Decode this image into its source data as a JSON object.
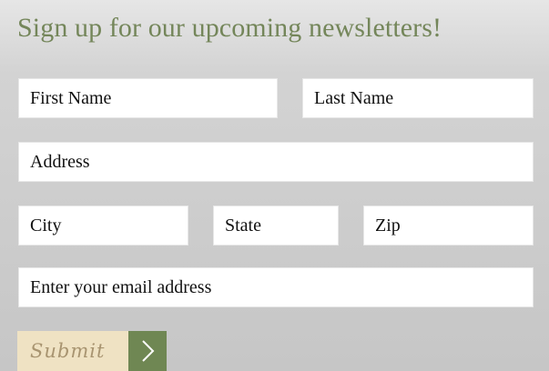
{
  "heading": "Sign up for our upcoming newsletters!",
  "fields": {
    "first_name": "First Name",
    "last_name": "Last Name",
    "address": "Address",
    "city": "City",
    "state": "State",
    "zip": "Zip",
    "email": "Enter your email address"
  },
  "submit": {
    "label": "Submit",
    "arrow_icon": "chevron-right-icon"
  },
  "colors": {
    "accent_green": "#6f8753",
    "heading_green": "#74865a",
    "submit_bg": "#efe2c3",
    "submit_text": "#a89470",
    "field_bg": "#ffffff"
  }
}
